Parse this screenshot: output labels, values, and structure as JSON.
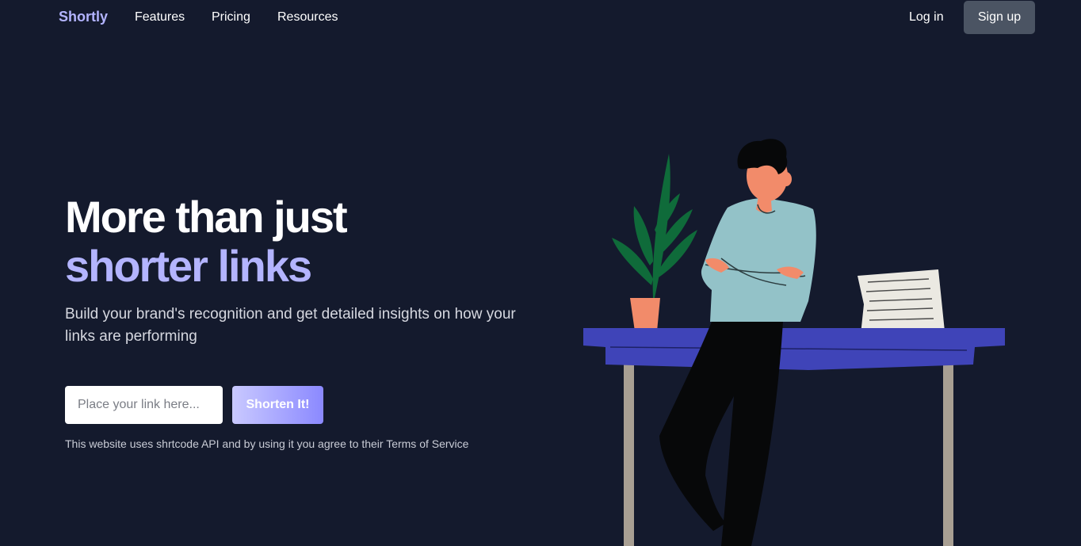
{
  "nav": {
    "logo": "Shortly",
    "links": [
      "Features",
      "Pricing",
      "Resources"
    ],
    "login": "Log in",
    "signup": "Sign up"
  },
  "hero": {
    "title_line1": "More than just",
    "title_line2": "shorter links",
    "subtitle": "Build your brand's recognition and get detailed insights on how your links are performing",
    "input_placeholder": "Place your link here...",
    "input_value": "",
    "button": "Shorten It!",
    "terms": "This website uses shrtcode API and by using it you agree to their Terms of Service"
  },
  "colors": {
    "background": "#141a2d",
    "accent": "#b3b4ff",
    "signup_bg": "#4b5463",
    "table": "#3f44b8"
  },
  "illustration": {
    "icon": "person-leaning-on-desk-illustration"
  }
}
